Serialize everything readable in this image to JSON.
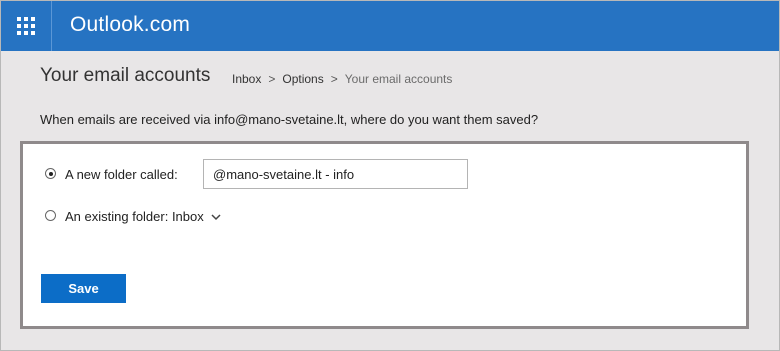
{
  "header": {
    "brand": "Outlook.com",
    "app_launcher_icon": "waffle-grid-icon",
    "color": "#2673c2"
  },
  "page": {
    "title": "Your email accounts",
    "breadcrumb": {
      "items": [
        "Inbox",
        "Options"
      ],
      "separator": ">",
      "current": "Your email accounts"
    },
    "question": "When emails are received via info@mano-svetaine.lt, where do you want them saved?"
  },
  "form": {
    "option_new_folder": {
      "label": "A new folder called:",
      "selected": true,
      "input_value": "@mano-svetaine.lt - info"
    },
    "option_existing_folder": {
      "label": "An existing folder: Inbox",
      "selected": false,
      "dropdown_icon": "chevron-down-icon"
    },
    "save_label": "Save",
    "save_color": "#0c6dc7"
  }
}
